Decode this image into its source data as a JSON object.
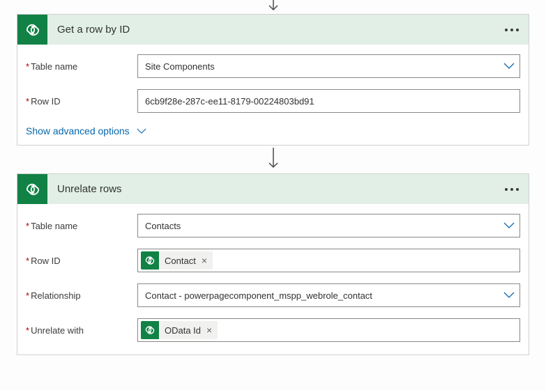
{
  "card1": {
    "title": "Get a row by ID",
    "table_label": "Table name",
    "table_value": "Site Components",
    "rowid_label": "Row ID",
    "rowid_value": "6cb9f28e-287c-ee11-8179-00224803bd91",
    "advanced_label": "Show advanced options"
  },
  "card2": {
    "title": "Unrelate rows",
    "table_label": "Table name",
    "table_value": "Contacts",
    "rowid_label": "Row ID",
    "rowid_token": "Contact",
    "relationship_label": "Relationship",
    "relationship_value": "Contact - powerpagecomponent_mspp_webrole_contact",
    "unrelate_label": "Unrelate with",
    "unrelate_token": "OData Id"
  }
}
